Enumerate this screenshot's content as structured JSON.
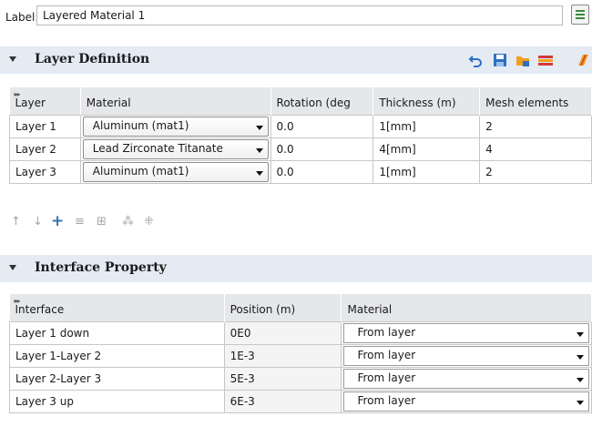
{
  "label": {
    "caption": "Label:",
    "value": "Layered Material 1",
    "icon": "edit-icon"
  },
  "layer_definition": {
    "title": "Layer Definition",
    "toolbar_icons": [
      "undo-icon",
      "save-icon",
      "load-folder-icon",
      "layer-icon",
      "layered-shell-icon"
    ],
    "columns": [
      "Layer",
      "Material",
      "Rotation (deg",
      "Thickness (m)",
      "Mesh elements"
    ],
    "rows": [
      {
        "layer": "Layer 1",
        "material": "Aluminum (mat1)",
        "rotation": "0.0",
        "thickness": "1[mm]",
        "mesh": "2"
      },
      {
        "layer": "Layer 2",
        "material": "Lead Zirconate Titanate",
        "rotation": "0.0",
        "thickness": "4[mm]",
        "mesh": "4"
      },
      {
        "layer": "Layer 3",
        "material": "Aluminum (mat1)",
        "rotation": "0.0",
        "thickness": "1[mm]",
        "mesh": "2"
      }
    ],
    "row_tools": {
      "move_up": "↑",
      "move_down": "↓",
      "add": "+",
      "delete": "≡",
      "clear": "⊞",
      "copy": "⁂",
      "paste": "⁜"
    }
  },
  "interface_property": {
    "title": "Interface Property",
    "columns": [
      "Interface",
      "Position (m)",
      "Material"
    ],
    "rows": [
      {
        "interface": "Layer 1 down",
        "position": "0E0",
        "material": "From layer"
      },
      {
        "interface": "Layer 1-Layer 2",
        "position": "1E-3",
        "material": "From layer"
      },
      {
        "interface": "Layer 2-Layer 3",
        "position": "5E-3",
        "material": "From layer"
      },
      {
        "interface": "Layer 3 up",
        "position": "6E-3",
        "material": "From layer"
      }
    ]
  },
  "colors": {
    "section_bg": "#e4ebf3",
    "header_bg": "#e5e7ea",
    "accent_blue": "#2f6fc2",
    "accent_orange": "#f0a020",
    "accent_red": "#d23a3a"
  }
}
